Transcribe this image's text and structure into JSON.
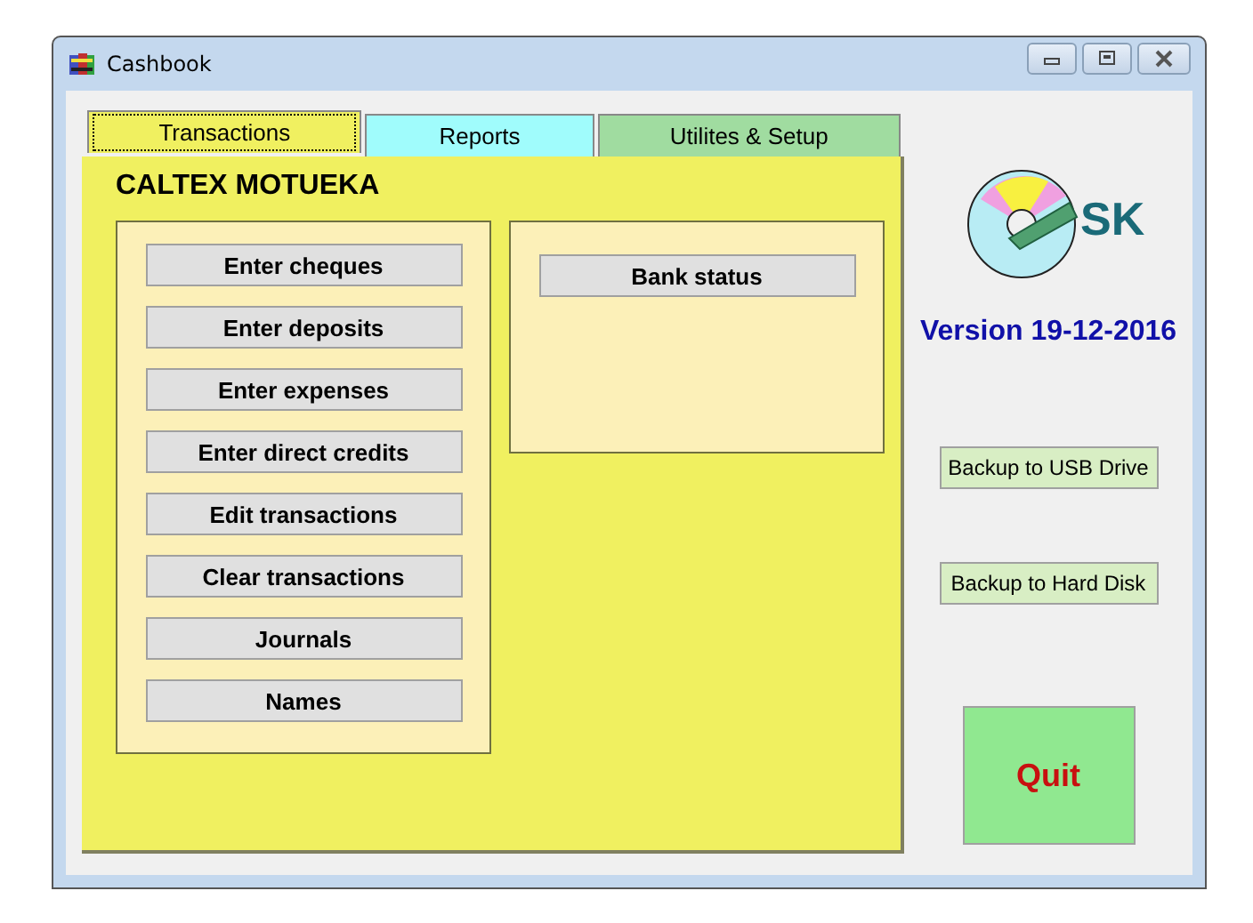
{
  "window": {
    "title": "Cashbook"
  },
  "tabs": [
    {
      "label": "Transactions",
      "selected": true,
      "color": "#f0f060"
    },
    {
      "label": "Reports",
      "selected": false,
      "color": "#a0fcfc"
    },
    {
      "label": "Utilites & Setup",
      "selected": false,
      "color": "#a0dca0"
    }
  ],
  "company": "CALTEX MOTUEKA",
  "left_group": [
    "Enter cheques",
    "Enter deposits",
    "Enter expenses",
    "Enter direct credits",
    "Edit transactions",
    "Clear transactions",
    "Journals",
    "Names"
  ],
  "right_group": [
    "Bank status"
  ],
  "logo": {
    "text": "SK"
  },
  "version": "Version 19-12-2016",
  "backup_buttons": [
    "Backup to USB Drive",
    "Backup to Hard Disk"
  ],
  "quit": "Quit"
}
